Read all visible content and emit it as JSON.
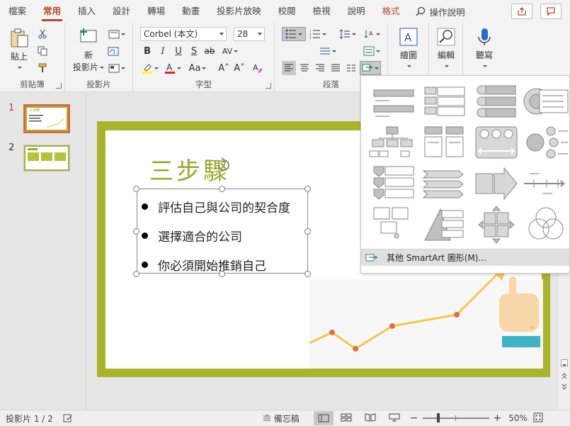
{
  "menu": {
    "tabs": [
      "檔案",
      "常用",
      "插入",
      "設計",
      "轉場",
      "動畫",
      "投影片放映",
      "校閱",
      "檢視",
      "說明",
      "格式"
    ],
    "help_label": "操作說明"
  },
  "ribbon": {
    "clipboard": {
      "label": "剪貼簿",
      "paste": "貼上"
    },
    "slides": {
      "label": "投影片",
      "new_slide_line1": "新",
      "new_slide_line2": "投影片"
    },
    "font": {
      "label": "字型",
      "font_name": "Corbel (本文)",
      "font_size": "28"
    },
    "paragraph": {
      "label": "段落"
    },
    "drawing": {
      "label": "繪圖"
    },
    "editing": {
      "label": "編輯"
    },
    "voice": {
      "label": "聽寫"
    }
  },
  "thumbnails": {
    "numbers": [
      "1",
      "2"
    ],
    "thumb1_title": "三步驟"
  },
  "slide": {
    "title": "三步驟",
    "bullets": [
      "評估自己與公司的契合度",
      "選擇適合的公司",
      "你必須開始推銷自己"
    ]
  },
  "smartart_gallery": {
    "more_label": "其他 SmartArt 圖形(M)..."
  },
  "statusbar": {
    "slide_info": "投影片 1 / 2",
    "notes_label": "備忘稿",
    "zoom": "50%"
  },
  "colors": {
    "accent": "#b7472a",
    "slide_border": "#a9b42a",
    "title_green": "#9aa82a"
  }
}
